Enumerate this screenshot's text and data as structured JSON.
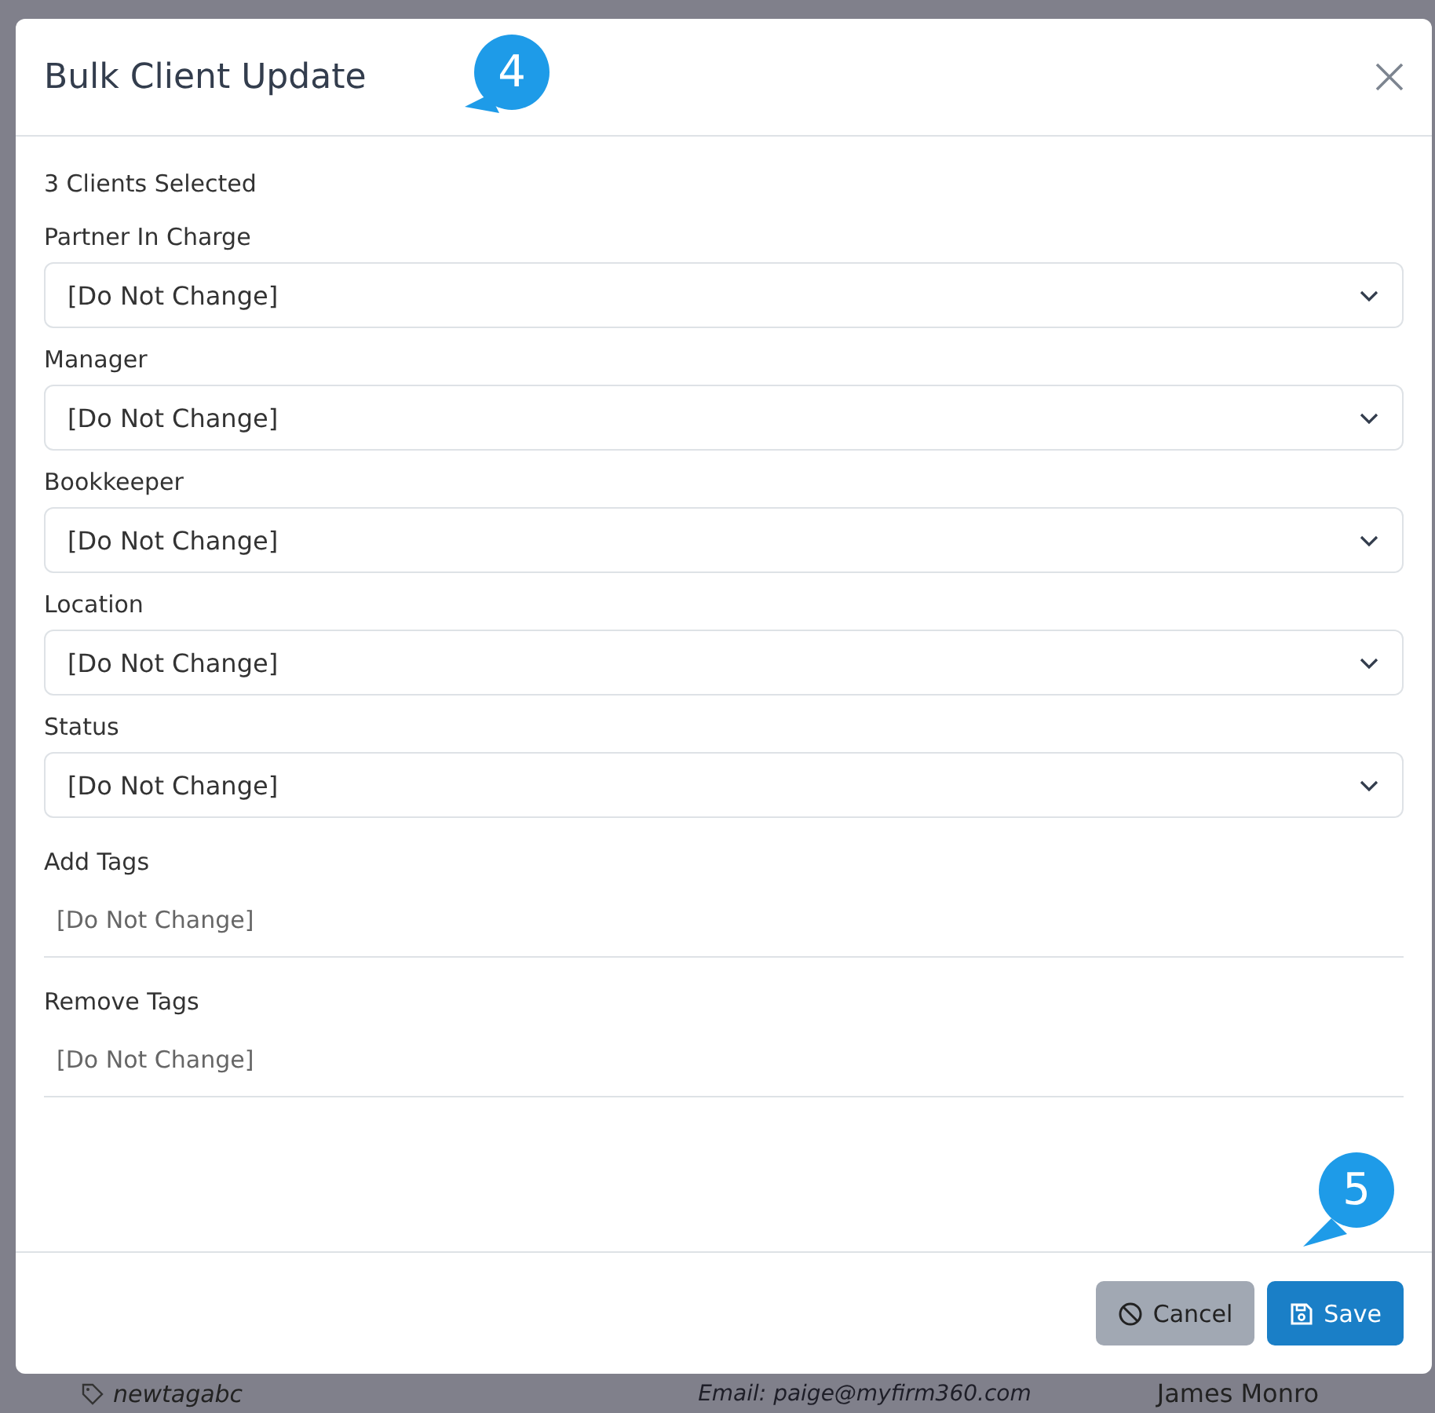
{
  "modal": {
    "title": "Bulk Client Update",
    "selection_count": "3 Clients Selected",
    "selects": [
      {
        "label": "Partner In Charge",
        "value": "[Do Not Change]"
      },
      {
        "label": "Manager",
        "value": "[Do Not Change]"
      },
      {
        "label": "Bookkeeper",
        "value": "[Do Not Change]"
      },
      {
        "label": "Location",
        "value": "[Do Not Change]"
      },
      {
        "label": "Status",
        "value": "[Do Not Change]"
      }
    ],
    "tag_fields": [
      {
        "label": "Add Tags",
        "placeholder": "[Do Not Change]"
      },
      {
        "label": "Remove Tags",
        "placeholder": "[Do Not Change]"
      }
    ],
    "buttons": [
      {
        "kind": "cancel",
        "label": "Cancel"
      },
      {
        "kind": "save",
        "label": "Save"
      }
    ]
  },
  "callouts": [
    {
      "number": "4",
      "kind": "upper"
    },
    {
      "number": "5",
      "kind": "lower"
    }
  ],
  "background": {
    "tag": "newtagabc",
    "email": "Email: paige@myfirm360.com",
    "contact": "James Monro"
  }
}
